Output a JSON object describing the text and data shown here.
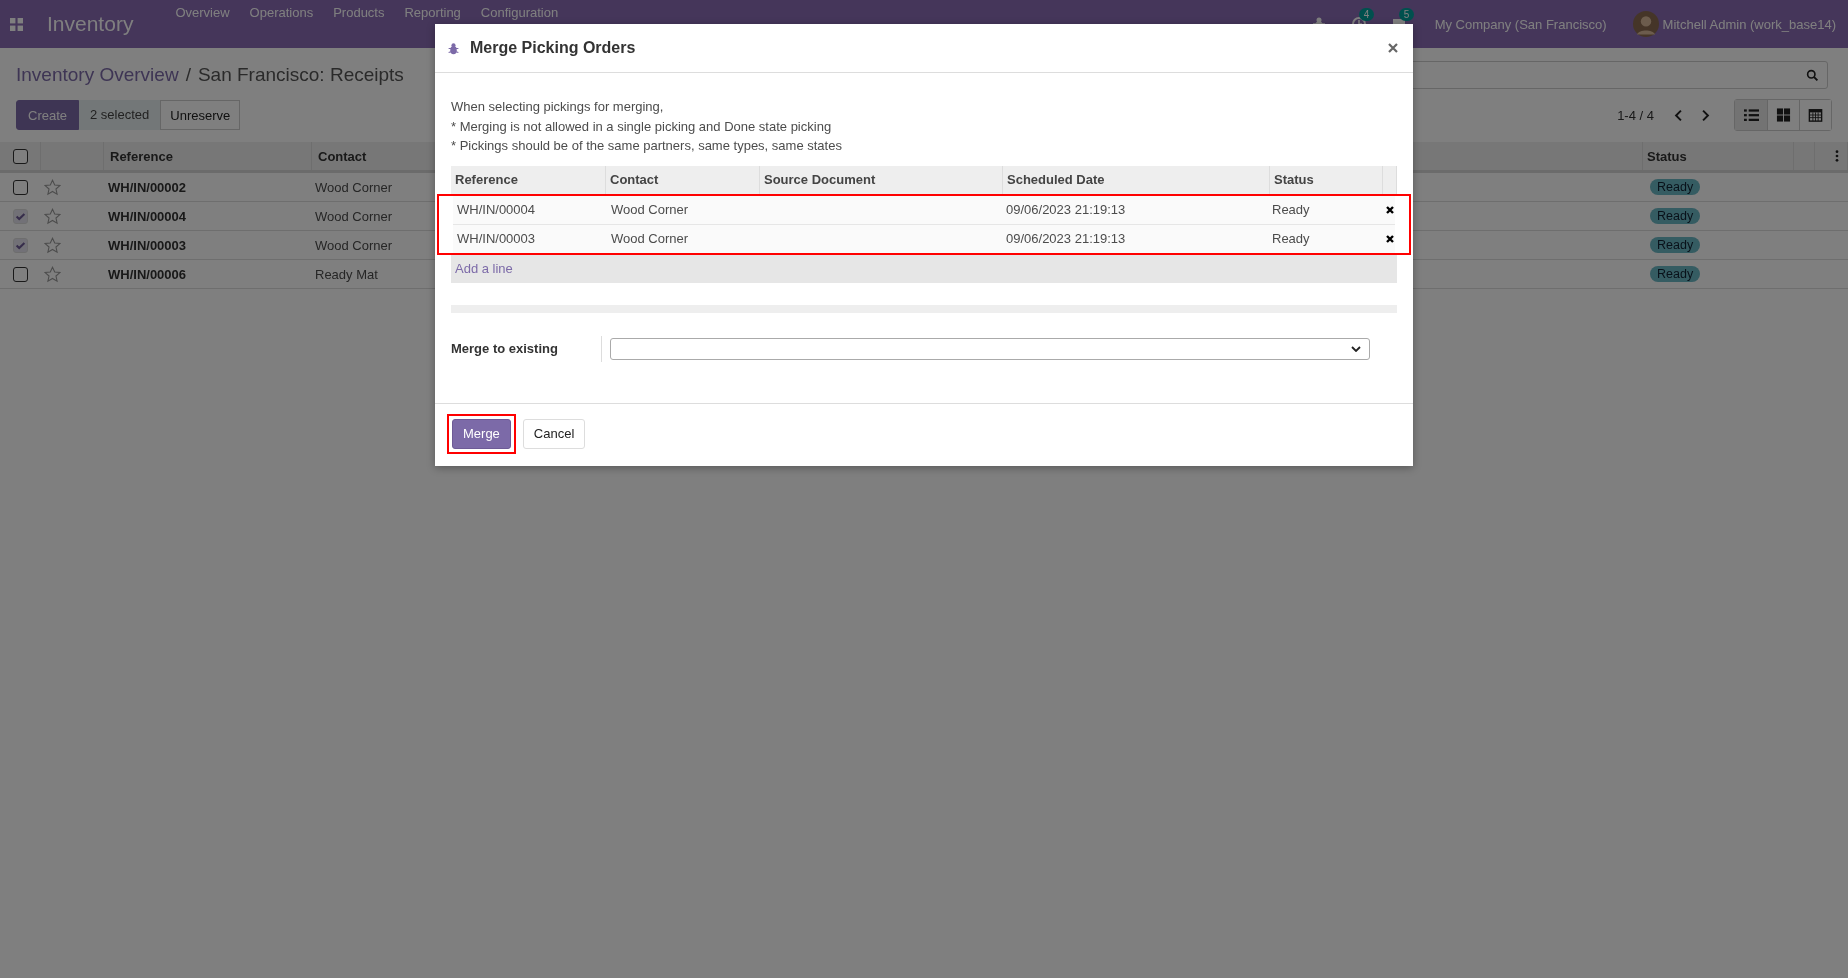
{
  "navbar": {
    "app_name": "Inventory",
    "menu": [
      {
        "label": "Overview"
      },
      {
        "label": "Operations"
      },
      {
        "label": "Products"
      },
      {
        "label": "Reporting"
      },
      {
        "label": "Configuration"
      }
    ],
    "activity_count": "4",
    "message_count": "5",
    "company": "My Company (San Francisco)",
    "user": "Mitchell Admin (work_base14)"
  },
  "breadcrumb": {
    "parent": "Inventory Overview",
    "separator": "/",
    "current": "San Francisco: Receipts"
  },
  "actions": {
    "create": "Create",
    "selected_count": "2 selected",
    "unreserve": "Unreserve"
  },
  "pager": "1-4 / 4",
  "views": [
    {
      "kind": "list",
      "selected": true
    },
    {
      "kind": "kanban",
      "selected": false
    },
    {
      "kind": "calendar",
      "selected": false
    }
  ],
  "list": {
    "all_selected": false,
    "columns": [
      "Reference",
      "Contact",
      "Status"
    ],
    "rows": [
      {
        "checked": false,
        "starred": false,
        "reference": "WH/IN/00002",
        "contact": "Wood Corner",
        "status": "Ready"
      },
      {
        "checked": true,
        "starred": false,
        "reference": "WH/IN/00004",
        "contact": "Wood Corner",
        "status": "Ready"
      },
      {
        "checked": true,
        "starred": false,
        "reference": "WH/IN/00003",
        "contact": "Wood Corner",
        "status": "Ready"
      },
      {
        "checked": false,
        "starred": false,
        "reference": "WH/IN/00006",
        "contact": "Ready Mat",
        "status": "Ready"
      }
    ]
  },
  "dialog": {
    "title": "Merge Picking Orders",
    "notes": [
      "When selecting pickings for merging,",
      "* Merging is not allowed in a single picking and Done state picking",
      "* Pickings should be of the same partners, same types, same states"
    ],
    "columns": [
      "Reference",
      "Contact",
      "Source Document",
      "Scheduled Date",
      "Status"
    ],
    "rows_highlighted": true,
    "rows": [
      {
        "reference": "WH/IN/00004",
        "contact": "Wood Corner",
        "scheduled_date": "09/06/2023 21:19:13",
        "status": "Ready"
      },
      {
        "reference": "WH/IN/00003",
        "contact": "Wood Corner",
        "scheduled_date": "09/06/2023 21:19:13",
        "status": "Ready"
      }
    ],
    "add_line": "Add a line",
    "merge_label": "Merge to existing",
    "buttons": [
      {
        "label": "Merge",
        "kind": "primary",
        "highlighted": true
      },
      {
        "label": "Cancel",
        "kind": "secondary",
        "highlighted": false
      }
    ]
  }
}
